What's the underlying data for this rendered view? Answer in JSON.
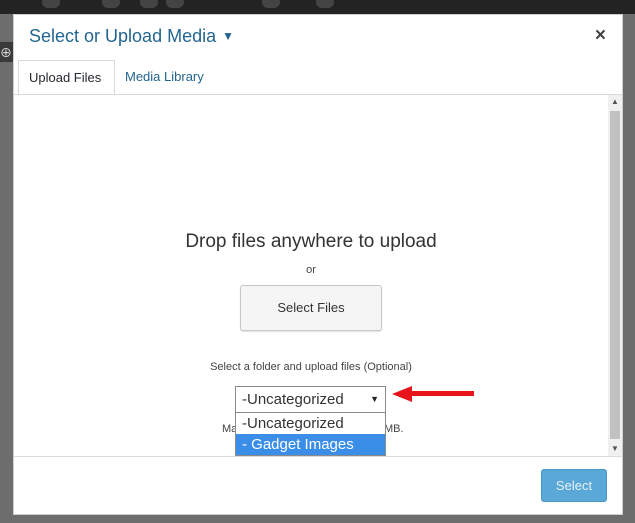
{
  "modal": {
    "title": "Select or Upload Media",
    "title_caret": "▼",
    "close_symbol": "×"
  },
  "tabs": [
    {
      "label": "Upload Files",
      "active": true
    },
    {
      "label": "Media Library",
      "active": false
    }
  ],
  "upload": {
    "drop_text": "Drop files anywhere to upload",
    "or_text": "or",
    "select_files_label": "Select Files",
    "folder_label": "Select a folder and upload files (Optional)",
    "max_text_start": "Ma",
    "max_text_end": "MB."
  },
  "folder_select": {
    "selected_value": "-Uncategorized",
    "options": [
      {
        "label": "-Uncategorized",
        "highlighted": false
      },
      {
        "label": "- Gadget Images",
        "highlighted": true
      }
    ]
  },
  "footer": {
    "select_button_label": "Select"
  },
  "colors": {
    "title": "#23658f",
    "link": "#23658f",
    "highlight": "#3b8ee8",
    "primary_button": "#5aa8d8",
    "arrow": "#e8141b"
  }
}
